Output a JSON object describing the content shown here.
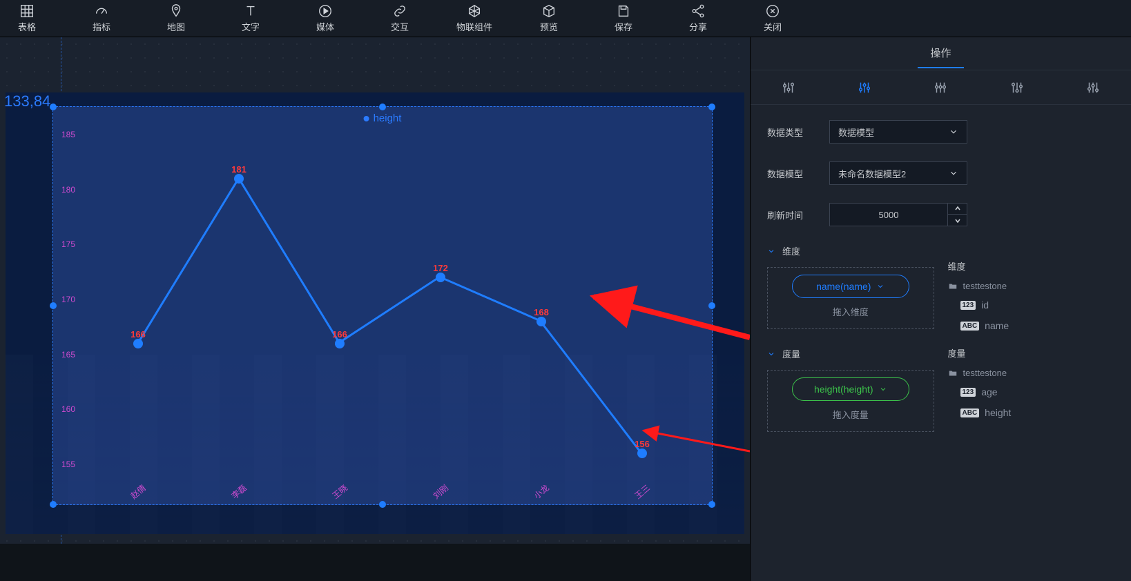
{
  "toolbar": [
    {
      "id": "table",
      "label": "表格"
    },
    {
      "id": "metric",
      "label": "指标"
    },
    {
      "id": "map",
      "label": "地图"
    },
    {
      "id": "text",
      "label": "文字"
    },
    {
      "id": "media",
      "label": "媒体"
    },
    {
      "id": "interact",
      "label": "交互"
    },
    {
      "id": "iot",
      "label": "物联组件"
    },
    {
      "id": "preview",
      "label": "预览"
    },
    {
      "id": "save",
      "label": "保存"
    },
    {
      "id": "share",
      "label": "分享"
    },
    {
      "id": "close",
      "label": "关闭"
    }
  ],
  "canvas": {
    "coord_label": "133,84",
    "legend": "height"
  },
  "chart_data": {
    "type": "line",
    "title": "height",
    "y_ticks": [
      155,
      160,
      165,
      170,
      175,
      180,
      185
    ],
    "x_ticks": [
      "赵倩",
      "李磊",
      "王晓",
      "刘刚",
      "小龙",
      "王三"
    ],
    "series": [
      {
        "name": "height",
        "values": [
          166,
          181,
          166,
          172,
          168,
          156
        ]
      }
    ],
    "ylabel": "",
    "xlabel": "",
    "ylim": [
      155,
      185
    ]
  },
  "right": {
    "tab_label": "操作",
    "data_type_label": "数据类型",
    "data_type_value": "数据模型",
    "data_model_label": "数据模型",
    "data_model_value": "未命名数据模型2",
    "refresh_label": "刷新时间",
    "refresh_value": "5000",
    "dim_header": "维度",
    "dim_chip": "name(name)",
    "dim_placeholder": "拖入维度",
    "mea_header": "度量",
    "mea_chip": "height(height)",
    "mea_placeholder": "拖入度量",
    "tree_dim_title": "维度",
    "tree_mea_title": "度量",
    "tree_table": "testtestone",
    "field_id": "id",
    "field_name": "name",
    "field_age": "age",
    "field_height": "height"
  }
}
